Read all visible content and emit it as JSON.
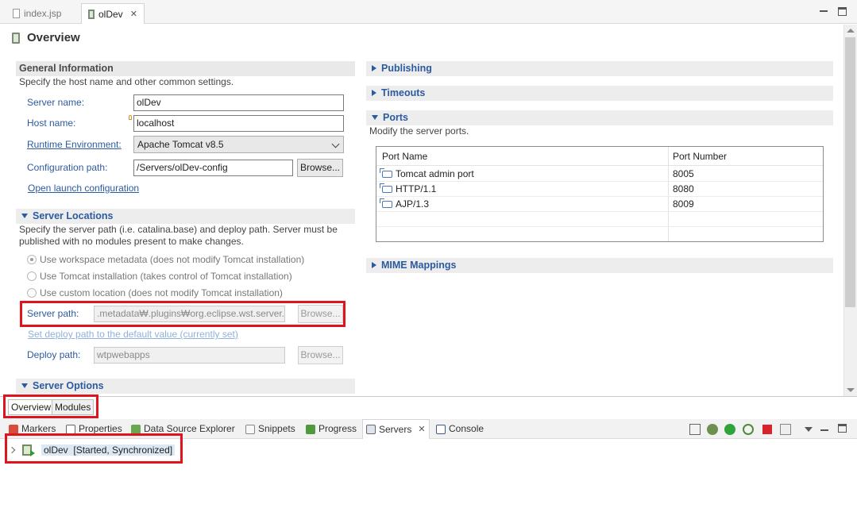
{
  "editor_tabs": [
    {
      "label": "index.jsp",
      "active": false,
      "icon": "file-icon"
    },
    {
      "label": "olDev",
      "active": true,
      "icon": "server-icon",
      "closable": true
    }
  ],
  "page_title": "Overview",
  "general": {
    "header": "General Information",
    "desc": "Specify the host name and other common settings.",
    "server_name_label": "Server name:",
    "server_name_value": "olDev",
    "host_name_label": "Host name:",
    "host_name_value": "localhost",
    "runtime_label": "Runtime Environment:",
    "runtime_value": "Apache Tomcat v8.5",
    "config_label": "Configuration path:",
    "config_value": "/Servers/olDev-config",
    "browse_label": "Browse...",
    "open_launch_label": "Open launch configuration"
  },
  "locations": {
    "header": "Server Locations",
    "desc_line1": "Specify the server path (i.e. catalina.base) and deploy path. Server must be",
    "desc_line2": "published with no modules present to make changes.",
    "options": [
      "Use workspace metadata (does not modify Tomcat installation)",
      "Use Tomcat installation (takes control of Tomcat installation)",
      "Use custom location (does not modify Tomcat installation)"
    ],
    "selected_option": 0,
    "server_path_label": "Server path:",
    "server_path_value": ".metadata₩.plugins₩org.eclipse.wst.server.c",
    "browse_label": "Browse...",
    "set_default_label": "Set deploy path to the default value (currently set)",
    "deploy_path_label": "Deploy path:",
    "deploy_path_value": "wtpwebapps",
    "deploy_browse_label": "Browse..."
  },
  "server_options": {
    "header": "Server Options"
  },
  "right_sections": {
    "publishing": "Publishing",
    "timeouts": "Timeouts",
    "ports": "Ports",
    "ports_desc": "Modify the server ports.",
    "mime": "MIME Mappings"
  },
  "ports_table": {
    "columns": [
      "Port Name",
      "Port Number"
    ],
    "rows": [
      {
        "name": "Tomcat admin port",
        "number": "8005"
      },
      {
        "name": "HTTP/1.1",
        "number": "8080"
      },
      {
        "name": "AJP/1.3",
        "number": "8009"
      }
    ]
  },
  "form_tabs": [
    "Overview",
    "Modules"
  ],
  "view_tabs": [
    {
      "label": "Markers",
      "icon": "markers-icon"
    },
    {
      "label": "Properties",
      "icon": "properties-icon"
    },
    {
      "label": "Data Source Explorer",
      "icon": "data-source-icon"
    },
    {
      "label": "Snippets",
      "icon": "snippets-icon"
    },
    {
      "label": "Progress",
      "icon": "progress-icon"
    },
    {
      "label": "Servers",
      "icon": "servers-icon",
      "active": true
    },
    {
      "label": "Console",
      "icon": "console-icon"
    }
  ],
  "servers_view": {
    "server_name": "olDev",
    "server_status": "[Started, Synchronized]"
  },
  "colors": {
    "accent_blue": "#2c5aa0",
    "highlight_red": "#e0141c",
    "section_bg": "#e9e9e9"
  }
}
